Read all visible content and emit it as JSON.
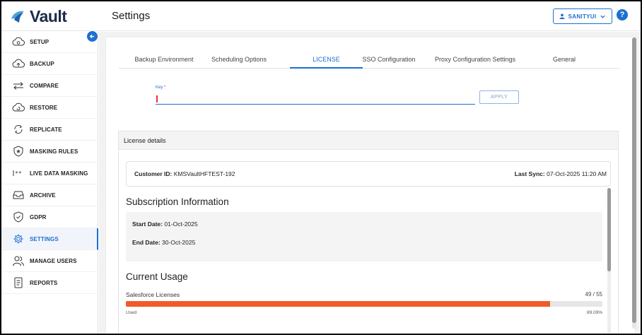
{
  "app": {
    "name": "Vault",
    "page_title": "Settings"
  },
  "user": {
    "name": "SANITYUI"
  },
  "sidebar": {
    "items": [
      {
        "label": "SETUP",
        "icon": "cloud-gear-icon"
      },
      {
        "label": "BACKUP",
        "icon": "cloud-upload-icon"
      },
      {
        "label": "COMPARE",
        "icon": "compare-arrows-icon"
      },
      {
        "label": "RESTORE",
        "icon": "cloud-restore-icon"
      },
      {
        "label": "REPLICATE",
        "icon": "replicate-icon"
      },
      {
        "label": "MASKING RULES",
        "icon": "shield-star-icon"
      },
      {
        "label": "LIVE DATA MASKING",
        "icon": "masking-icon"
      },
      {
        "label": "ARCHIVE",
        "icon": "archive-icon"
      },
      {
        "label": "GDPR",
        "icon": "shield-check-icon"
      },
      {
        "label": "SETTINGS",
        "icon": "gear-icon"
      },
      {
        "label": "MANAGE USERS",
        "icon": "users-icon"
      },
      {
        "label": "REPORTS",
        "icon": "report-icon"
      }
    ],
    "active": "SETTINGS"
  },
  "tabs": [
    "Backup Environment",
    "Scheduling Options",
    "LICENSE",
    "SSO Configuration",
    "Proxy Configuration Settings",
    "General"
  ],
  "active_tab": "LICENSE",
  "key_field": {
    "label": "Key",
    "required_mark": "*",
    "value": ""
  },
  "apply_label": "APPLY",
  "license": {
    "header": "License details",
    "customer_id_label": "Customer ID:",
    "customer_id": "KMSVaultHFTEST-192",
    "last_sync_label": "Last Sync:",
    "last_sync": "07-Oct-2025 11:20 AM",
    "subscription_title": "Subscription Information",
    "start_label": "Start Date:",
    "start_date": "01-Oct-2025",
    "end_label": "End Date:",
    "end_date": "30-Oct-2025",
    "usage_title": "Current Usage",
    "usage": {
      "name": "Salesforce Licenses",
      "count_text": "49 / 55",
      "used": 49,
      "total": 55,
      "used_label": "Used",
      "percent_text": "89.09%",
      "bar_color": "#f15a29"
    }
  },
  "colors": {
    "accent": "#1d6fd1",
    "brand": "#1a2b4a"
  }
}
